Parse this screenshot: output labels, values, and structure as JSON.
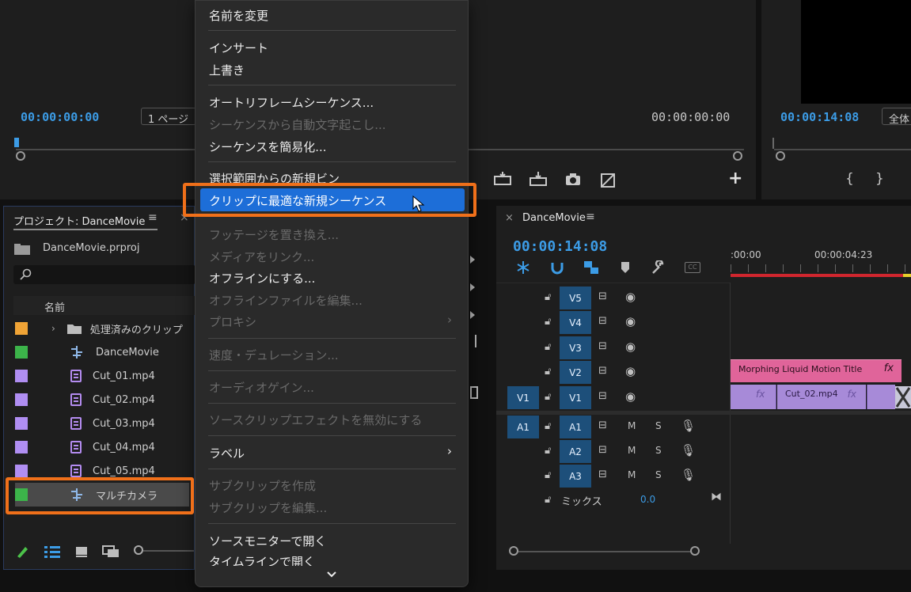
{
  "source_monitor": {
    "timecode_in": "00:00:00:00",
    "page_dropdown": "1 ページ",
    "timecode_out": "00:00:00:00"
  },
  "program_monitor": {
    "timecode": "00:00:14:08",
    "fit_dropdown": "全体"
  },
  "project": {
    "title": "プロジェクト: DanceMovie",
    "file_name": "DanceMovie.prproj",
    "search_placeholder": "",
    "column_name": "名前",
    "items": [
      {
        "label": "処理済みのクリップ",
        "color": "#f0a436",
        "kind": "folder"
      },
      {
        "label": "DanceMovie",
        "color": "#3cb44a",
        "kind": "sequence"
      },
      {
        "label": "Cut_01.mp4",
        "color": "#b08ef2",
        "kind": "video"
      },
      {
        "label": "Cut_02.mp4",
        "color": "#b08ef2",
        "kind": "video"
      },
      {
        "label": "Cut_03.mp4",
        "color": "#b08ef2",
        "kind": "video"
      },
      {
        "label": "Cut_04.mp4",
        "color": "#b08ef2",
        "kind": "video"
      },
      {
        "label": "Cut_05.mp4",
        "color": "#b08ef2",
        "kind": "video"
      },
      {
        "label": "マルチカメラ",
        "color": "#3cb44a",
        "kind": "sequence",
        "selected": true
      }
    ]
  },
  "context_menu": {
    "items": [
      {
        "label": "名前を変更",
        "enabled": true
      },
      {
        "label": "インサート",
        "enabled": true
      },
      {
        "label": "上書き",
        "enabled": true
      },
      {
        "label": "オートリフレームシーケンス...",
        "enabled": true
      },
      {
        "label": "シーケンスから自動文字起こし...",
        "enabled": false
      },
      {
        "label": "シーケンスを簡易化...",
        "enabled": true
      },
      {
        "label": "選択範囲からの新規ビン",
        "enabled": true
      },
      {
        "label": "クリップに最適な新規シーケンス",
        "enabled": true,
        "highlighted": true
      },
      {
        "label": "フッテージを置き換え...",
        "enabled": false
      },
      {
        "label": "メディアをリンク...",
        "enabled": false
      },
      {
        "label": "オフラインにする...",
        "enabled": true
      },
      {
        "label": "オフラインファイルを編集...",
        "enabled": false
      },
      {
        "label": "プロキシ",
        "enabled": false,
        "submenu": true
      },
      {
        "label": "速度・デュレーション...",
        "enabled": false
      },
      {
        "label": "オーディオゲイン...",
        "enabled": false
      },
      {
        "label": "ソースクリップエフェクトを無効にする",
        "enabled": false
      },
      {
        "label": "ラベル",
        "enabled": true,
        "submenu": true
      },
      {
        "label": "サブクリップを作成",
        "enabled": false
      },
      {
        "label": "サブクリップを編集...",
        "enabled": false
      },
      {
        "label": "ソースモニターで開く",
        "enabled": true
      },
      {
        "label": "タイムラインで開く",
        "enabled": true
      }
    ]
  },
  "timeline": {
    "tab_title": "DanceMovie",
    "timecode": "00:00:14:08",
    "ruler_start": ":00:00",
    "ruler_mark": "00:00:04:23",
    "video_tracks": [
      "V5",
      "V4",
      "V3",
      "V2",
      "V1"
    ],
    "audio_tracks": [
      "A1",
      "A2",
      "A3"
    ],
    "source_v": "V1",
    "source_a": "A1",
    "mute": "M",
    "solo": "S",
    "mix_label": "ミックス",
    "mix_value": "0.0",
    "title_clip": "Morphing Liquid Motion Title",
    "video_clip": "Cut_02.mp4",
    "fx": "fx"
  },
  "colors": {
    "accent_blue": "#3c9ce6",
    "highlight": "#1d6ed8",
    "callout": "#f0701a",
    "pink_clip": "#e0649a",
    "violet_clip": "#a78ad8"
  }
}
